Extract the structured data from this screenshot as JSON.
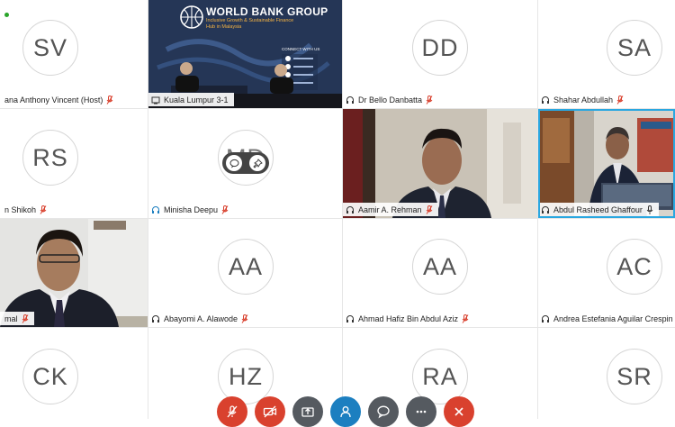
{
  "participants": [
    {
      "initials": "SV",
      "name": "ana Anthony Vincent (Host)",
      "audio": "muted"
    },
    {
      "name": "Kuala Lumpur 3-1",
      "video": true
    },
    {
      "initials": "DD",
      "name": "Dr Bello Danbatta",
      "audio": "muted"
    },
    {
      "initials": "SA",
      "name": "Shahar Abdullah",
      "audio": "muted"
    },
    {
      "initials": "RS",
      "name": "n Shikoh",
      "audio": "muted"
    },
    {
      "initials": "MD",
      "name": "Minisha Deepu",
      "audio": "muted"
    },
    {
      "name": "Aamir A. Rehman",
      "audio": "muted",
      "video": true
    },
    {
      "name": "Abdul Rasheed Ghaffour",
      "audio": "on",
      "video": true,
      "active_speaker": true
    },
    {
      "name": "mal",
      "audio": "muted",
      "video": true
    },
    {
      "initials": "AA",
      "name": "Abayomi A. Alawode",
      "audio": "muted"
    },
    {
      "initials": "AA",
      "name": "Ahmad Hafiz Bin Abdul Aziz",
      "audio": "muted"
    },
    {
      "initials": "AC",
      "name": "Andrea Estefania Aguilar Crespin",
      "audio": "muted"
    },
    {
      "initials": "CK"
    },
    {
      "initials": "HZ"
    },
    {
      "initials": "RA"
    },
    {
      "initials": "SR"
    }
  ],
  "banner": {
    "title": "WORLD BANK GROUP",
    "subtitle1": "Inclusive Growth & Sustainable Finance",
    "subtitle2": "Hub in Malaysia",
    "connect": "CONNECT WITH US"
  },
  "toolbar": {
    "buttons": [
      {
        "icon": "mic-muted-icon",
        "color": "#d9412e"
      },
      {
        "icon": "video-off-icon",
        "color": "#d9412e"
      },
      {
        "icon": "share-icon",
        "color": "#555a60"
      },
      {
        "icon": "participants-icon",
        "color": "#1c7fc0"
      },
      {
        "icon": "chat-icon",
        "color": "#555a60"
      },
      {
        "icon": "more-icon",
        "color": "#555a60"
      },
      {
        "icon": "leave-icon",
        "color": "#d9412e"
      }
    ]
  },
  "colors": {
    "active_speaker": "#2aa7e0",
    "muted_mic": "#d9412e"
  }
}
